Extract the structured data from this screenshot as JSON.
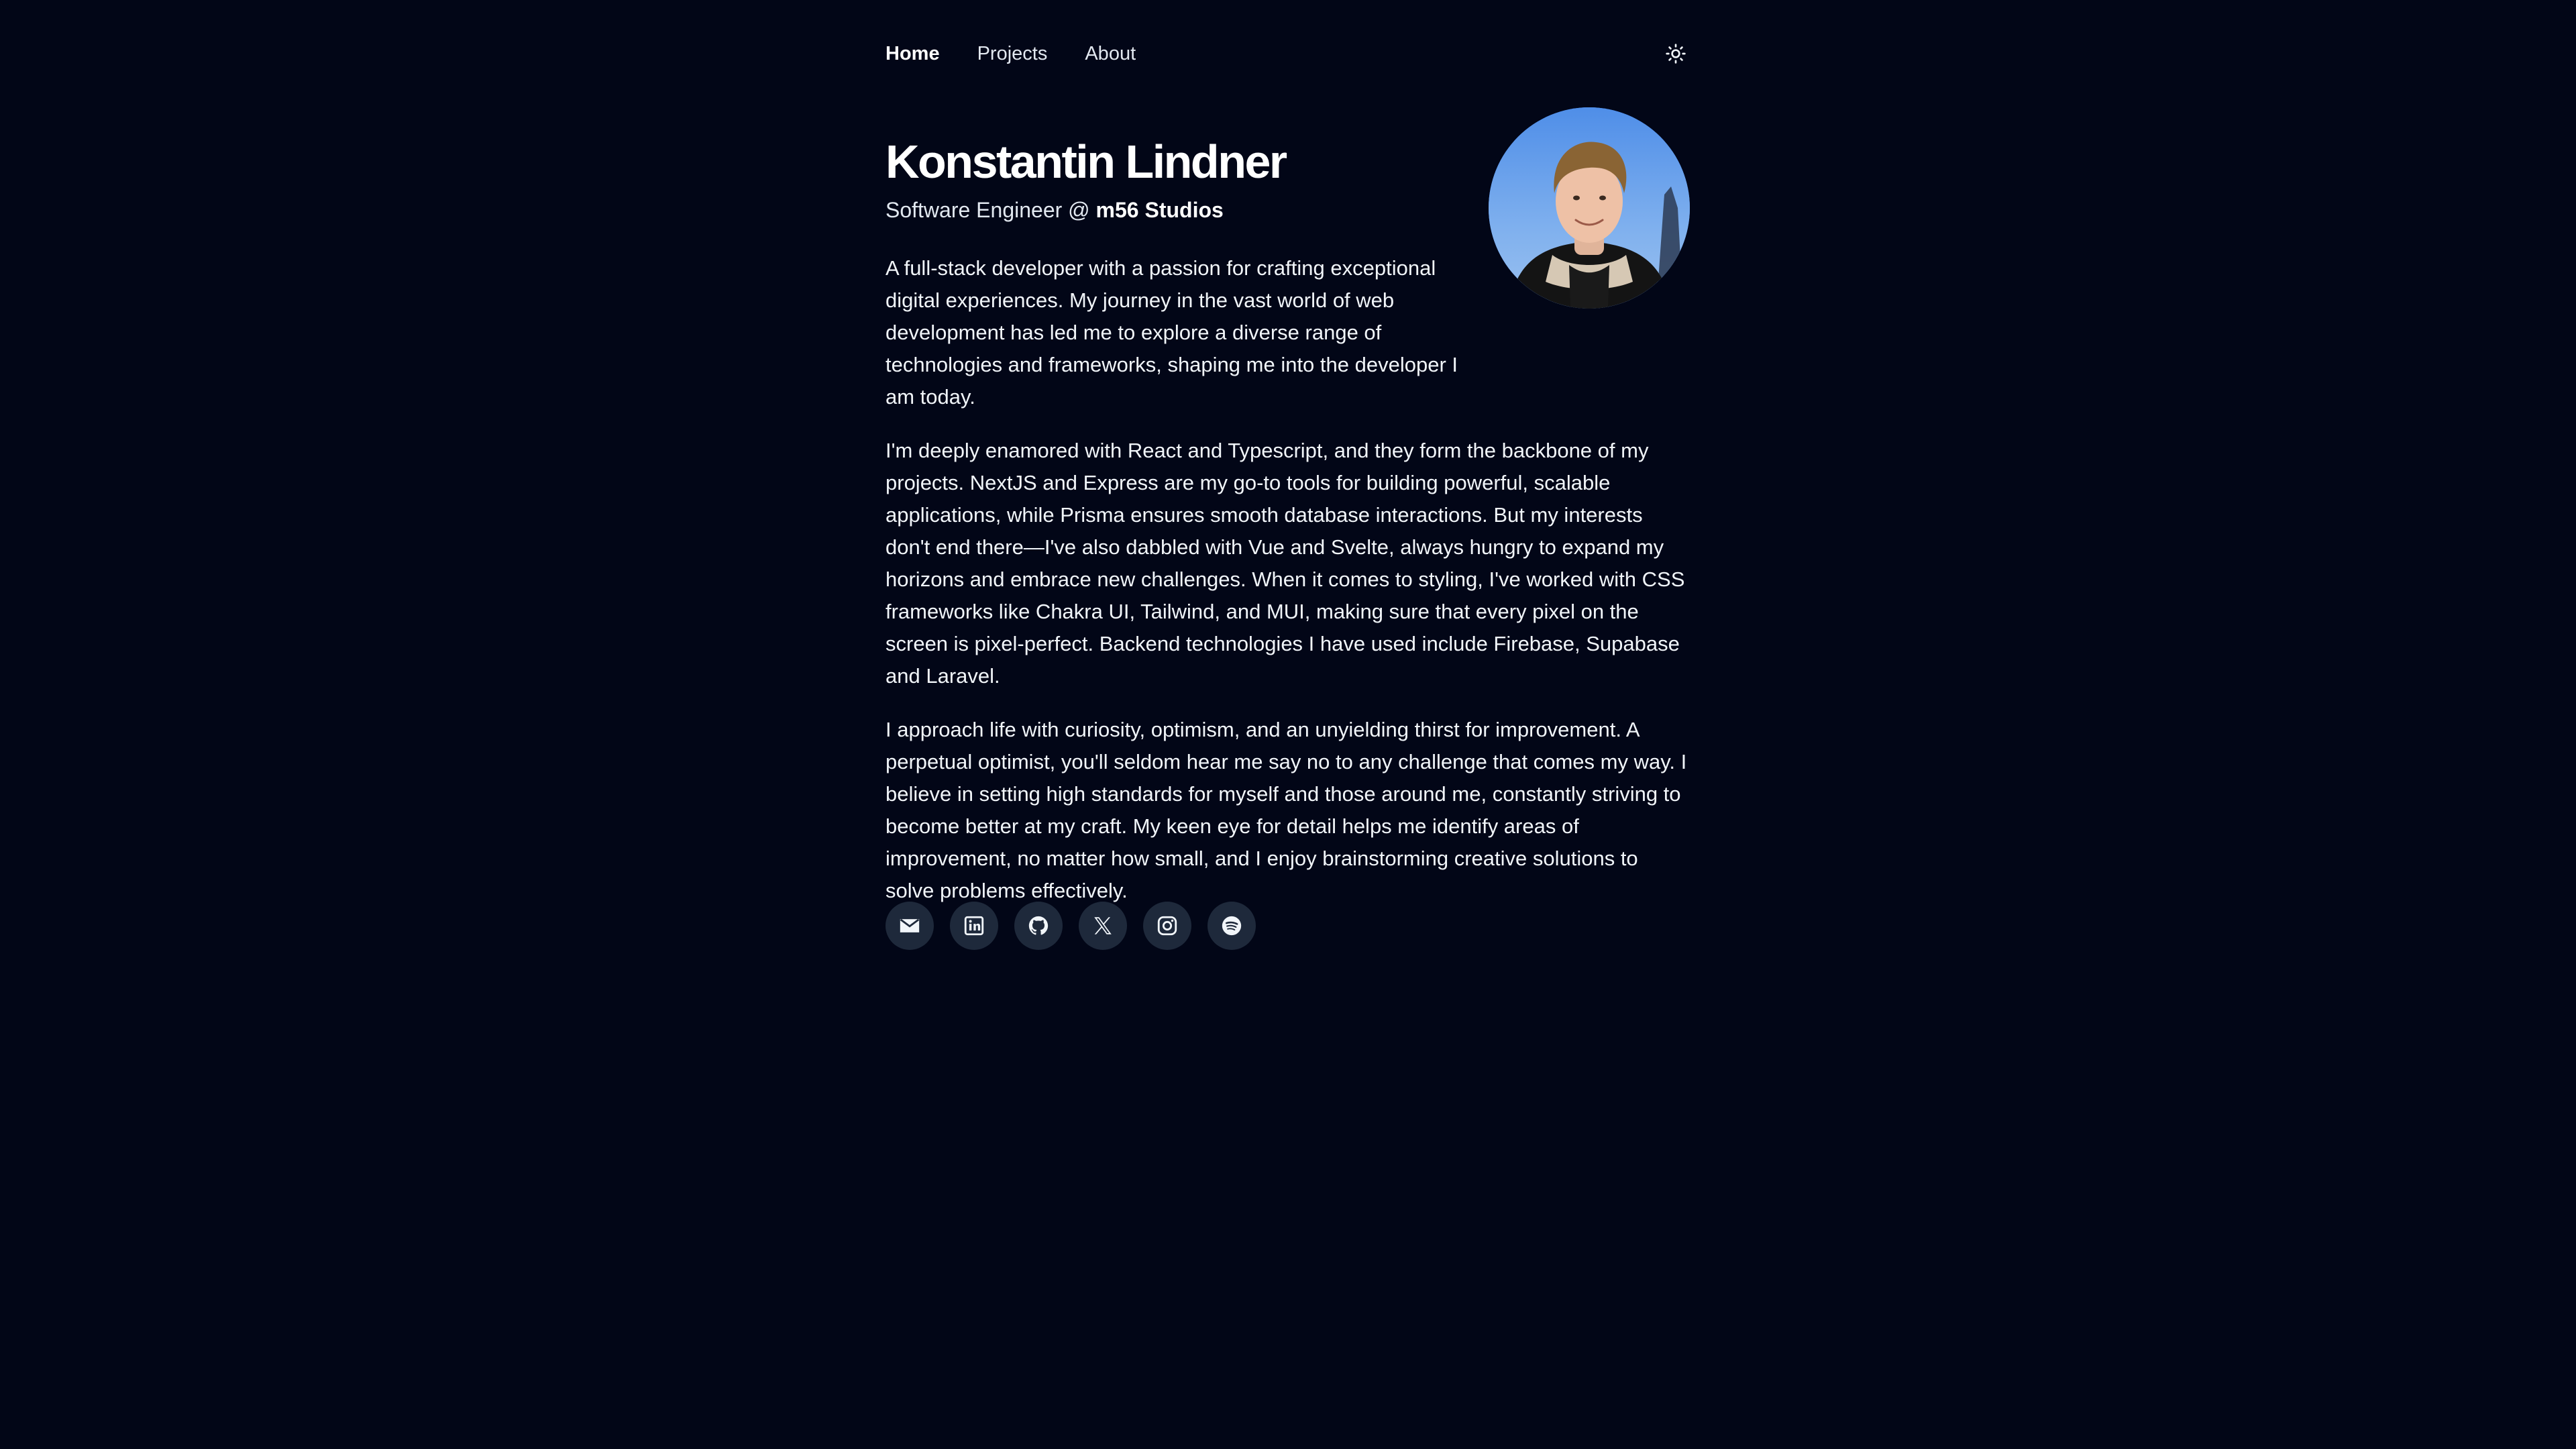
{
  "nav": {
    "links": [
      {
        "label": "Home",
        "active": true
      },
      {
        "label": "Projects",
        "active": false
      },
      {
        "label": "About",
        "active": false
      }
    ],
    "theme_toggle_icon": "sun-icon"
  },
  "profile": {
    "name": "Konstantin Lindner",
    "subtitle_prefix": "Software Engineer @ ",
    "company": "m56 Studios"
  },
  "bio": {
    "paragraphs": [
      "A full-stack developer with a passion for crafting exceptional digital experiences. My journey in the vast world of web development has led me to explore a diverse range of technologies and frameworks, shaping me into the developer I am today.",
      "I'm deeply enamored with React and Typescript, and they form the backbone of my projects. NextJS and Express are my go-to tools for building powerful, scalable applications, while Prisma ensures smooth database interactions. But my interests don't end there—I've also dabbled with Vue and Svelte, always hungry to expand my horizons and embrace new challenges. When it comes to styling, I've worked with CSS frameworks like Chakra UI, Tailwind, and MUI, making sure that every pixel on the screen is pixel-perfect. Backend technologies I have used include Firebase, Supabase and Laravel.",
      "I approach life with curiosity, optimism, and an unyielding thirst for improvement. A perpetual optimist, you'll seldom hear me say no to any challenge that comes my way. I believe in setting high standards for myself and those around me, constantly striving to become better at my craft. My keen eye for detail helps me identify areas of improvement, no matter how small, and I enjoy brainstorming creative solutions to solve problems effectively."
    ]
  },
  "socials": [
    {
      "icon": "mail-icon"
    },
    {
      "icon": "linkedin-icon"
    },
    {
      "icon": "github-icon"
    },
    {
      "icon": "x-icon"
    },
    {
      "icon": "instagram-icon"
    },
    {
      "icon": "spotify-icon"
    }
  ],
  "colors": {
    "background": "#020617",
    "text": "#f1f5f9",
    "social_bg": "#1e293b"
  }
}
